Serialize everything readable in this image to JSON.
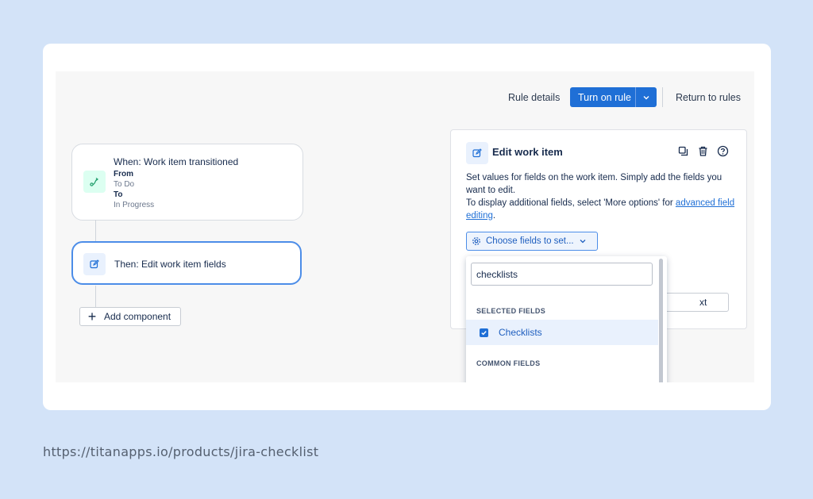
{
  "toolbar": {
    "rule_details": "Rule details",
    "turn_on_rule": "Turn on rule",
    "return_to_rules": "Return to rules"
  },
  "flow": {
    "trigger": {
      "title": "When: Work item transitioned",
      "from_label": "From",
      "from_value": "To Do",
      "to_label": "To",
      "to_value": "In Progress"
    },
    "action": {
      "title": "Then: Edit work item fields"
    },
    "add_component": "Add component"
  },
  "panel": {
    "title": "Edit work item",
    "desc_line1": "Set values for fields on the work item. Simply add the fields you want to edit.",
    "desc_line2_pre": "To display additional fields, select 'More options' for ",
    "desc_link": "advanced field editing",
    "desc_line2_post": ".",
    "choose_fields": "Choose fields to set...",
    "next_partial": "xt"
  },
  "dropdown": {
    "search_value": "checklists",
    "section_selected": "SELECTED FIELDS",
    "selected_item": "Checklists",
    "section_common": "COMMON FIELDS"
  },
  "footer": {
    "url": "https://titanapps.io/products/jira-checklist"
  },
  "colors": {
    "accent": "#1f6fd6",
    "background": "#d3e3f8"
  }
}
